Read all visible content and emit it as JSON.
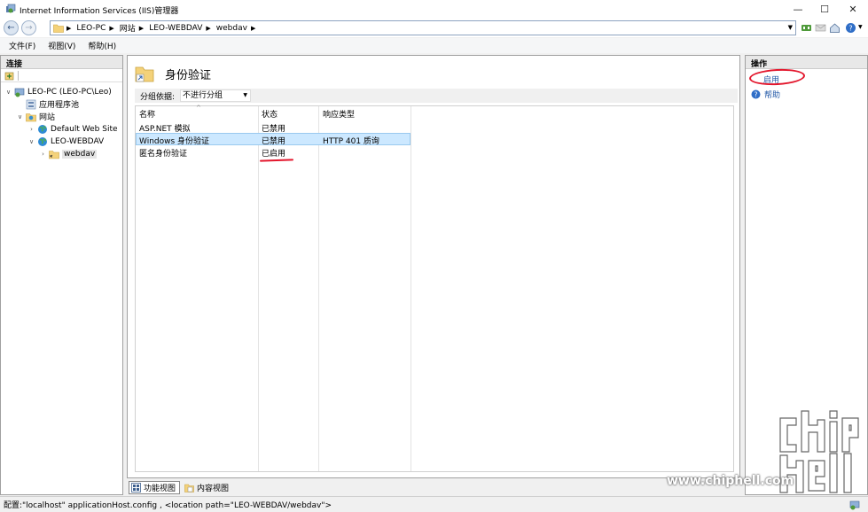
{
  "window": {
    "title": "Internet Information Services (IIS)管理器",
    "controls": {
      "minimize": "—",
      "maximize": "☐",
      "close": "✕"
    }
  },
  "address": {
    "breadcrumbs": [
      "LEO-PC",
      "网站",
      "LEO-WEBDAV",
      "webdav"
    ]
  },
  "menu": {
    "items": [
      "文件(F)",
      "视图(V)",
      "帮助(H)"
    ]
  },
  "connections": {
    "header": "连接",
    "tree": {
      "server": "LEO-PC (LEO-PC\\Leo)",
      "app_pools": "应用程序池",
      "sites": "网站",
      "default_site": "Default Web Site",
      "webdav_site": "LEO-WEBDAV",
      "webdav_app": "webdav"
    }
  },
  "feature": {
    "title": "身份验证",
    "group_label": "分组依据:",
    "group_value": "不进行分组",
    "columns": {
      "name": "名称",
      "status": "状态",
      "response_type": "响应类型"
    },
    "rows": [
      {
        "name": "ASP.NET 模拟",
        "status": "已禁用",
        "response_type": ""
      },
      {
        "name": "Windows 身份验证",
        "status": "已禁用",
        "response_type": "HTTP 401 质询"
      },
      {
        "name": "匿名身份验证",
        "status": "已启用",
        "response_type": ""
      }
    ]
  },
  "view_tabs": {
    "features": "功能视图",
    "content": "内容视图"
  },
  "actions": {
    "header": "操作",
    "enable": "启用",
    "help": "帮助"
  },
  "status_bar": {
    "text": "配置:\"localhost\" applicationHost.config , <location path=\"LEO-WEBDAV/webdav\">"
  },
  "watermark": {
    "text": "www.chiphell.com"
  },
  "colors": {
    "annotation": "#e3162c",
    "selection": "#cce8ff",
    "link": "#1f56a6"
  }
}
